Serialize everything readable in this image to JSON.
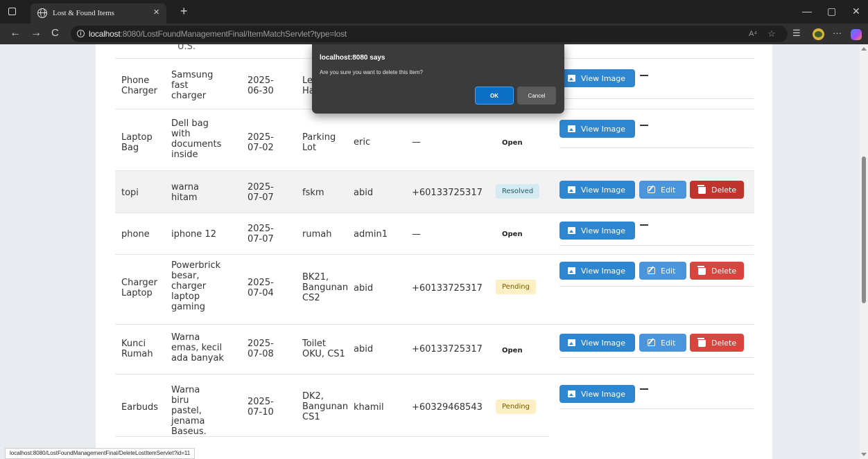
{
  "browser": {
    "tab_title": "Lost & Found Items",
    "tab_close": "×",
    "new_tab": "+",
    "url_host": "localhost",
    "url_rest": ":8080/LostFoundManagementFinal/ItemMatchServlet?type=lost",
    "read_aloud": "A⁴",
    "favorites_icon": "☆",
    "collections_icon": "⭐",
    "more_icon": "···",
    "minimize": "—",
    "maximize": "▢",
    "close": "✕",
    "back": "←",
    "forward": "→",
    "refresh": "C"
  },
  "partial_text": "U.S.",
  "rows": [
    {
      "item": "Phone Charger",
      "description": "Samsung fast charger",
      "date": "2025-06-30",
      "location": "Lecture Hall",
      "reporter": "",
      "contact": "",
      "status": "",
      "status_type": "",
      "owner": false
    },
    {
      "item": "Laptop Bag",
      "description": "Dell bag with documents inside",
      "date": "2025-07-02",
      "location": "Parking Lot",
      "reporter": "eric",
      "contact": "—",
      "status": "Open",
      "status_type": "open",
      "owner": false
    },
    {
      "item": "topi",
      "description": "warna hitam",
      "date": "2025-07-07",
      "location": "fskm",
      "reporter": "abid",
      "contact": "+60133725317",
      "status": "Resolved",
      "status_type": "resolved",
      "owner": true
    },
    {
      "item": "phone",
      "description": "iphone 12",
      "date": "2025-07-07",
      "location": "rumah",
      "reporter": "admin1",
      "contact": "—",
      "status": "Open",
      "status_type": "open",
      "owner": false
    },
    {
      "item": "Charger Laptop",
      "description": "Powerbrick besar, charger laptop gaming",
      "date": "2025-07-04",
      "location": "BK21, Bangunan CS2",
      "reporter": "abid",
      "contact": "+60133725317",
      "status": "Pending",
      "status_type": "pending",
      "owner": true
    },
    {
      "item": "Kunci Rumah",
      "description": "Warna emas, kecil ada banyak",
      "date": "2025-07-08",
      "location": "Toilet OKU, CS1",
      "reporter": "abid",
      "contact": "+60133725317",
      "status": "Open",
      "status_type": "open",
      "owner": true
    },
    {
      "item": "Earbuds",
      "description": "Warna biru pastel, jenama Baseus.",
      "date": "2025-07-10",
      "location": "DK2, Bangunan CS1",
      "reporter": "khamil",
      "contact": "+60329468543",
      "status": "Pending",
      "status_type": "pending",
      "owner": false
    }
  ],
  "actions": {
    "view_image": "View Image",
    "edit": "Edit",
    "delete": "Delete",
    "no_action": "—"
  },
  "dialog": {
    "title": "localhost:8080 says",
    "message": "Are you sure you want to delete this item?",
    "ok": "OK",
    "cancel": "Cancel"
  },
  "status_bar": {
    "link": "localhost:8080/LostFoundManagementFinal/DeleteLostItemServlet?id=11"
  }
}
